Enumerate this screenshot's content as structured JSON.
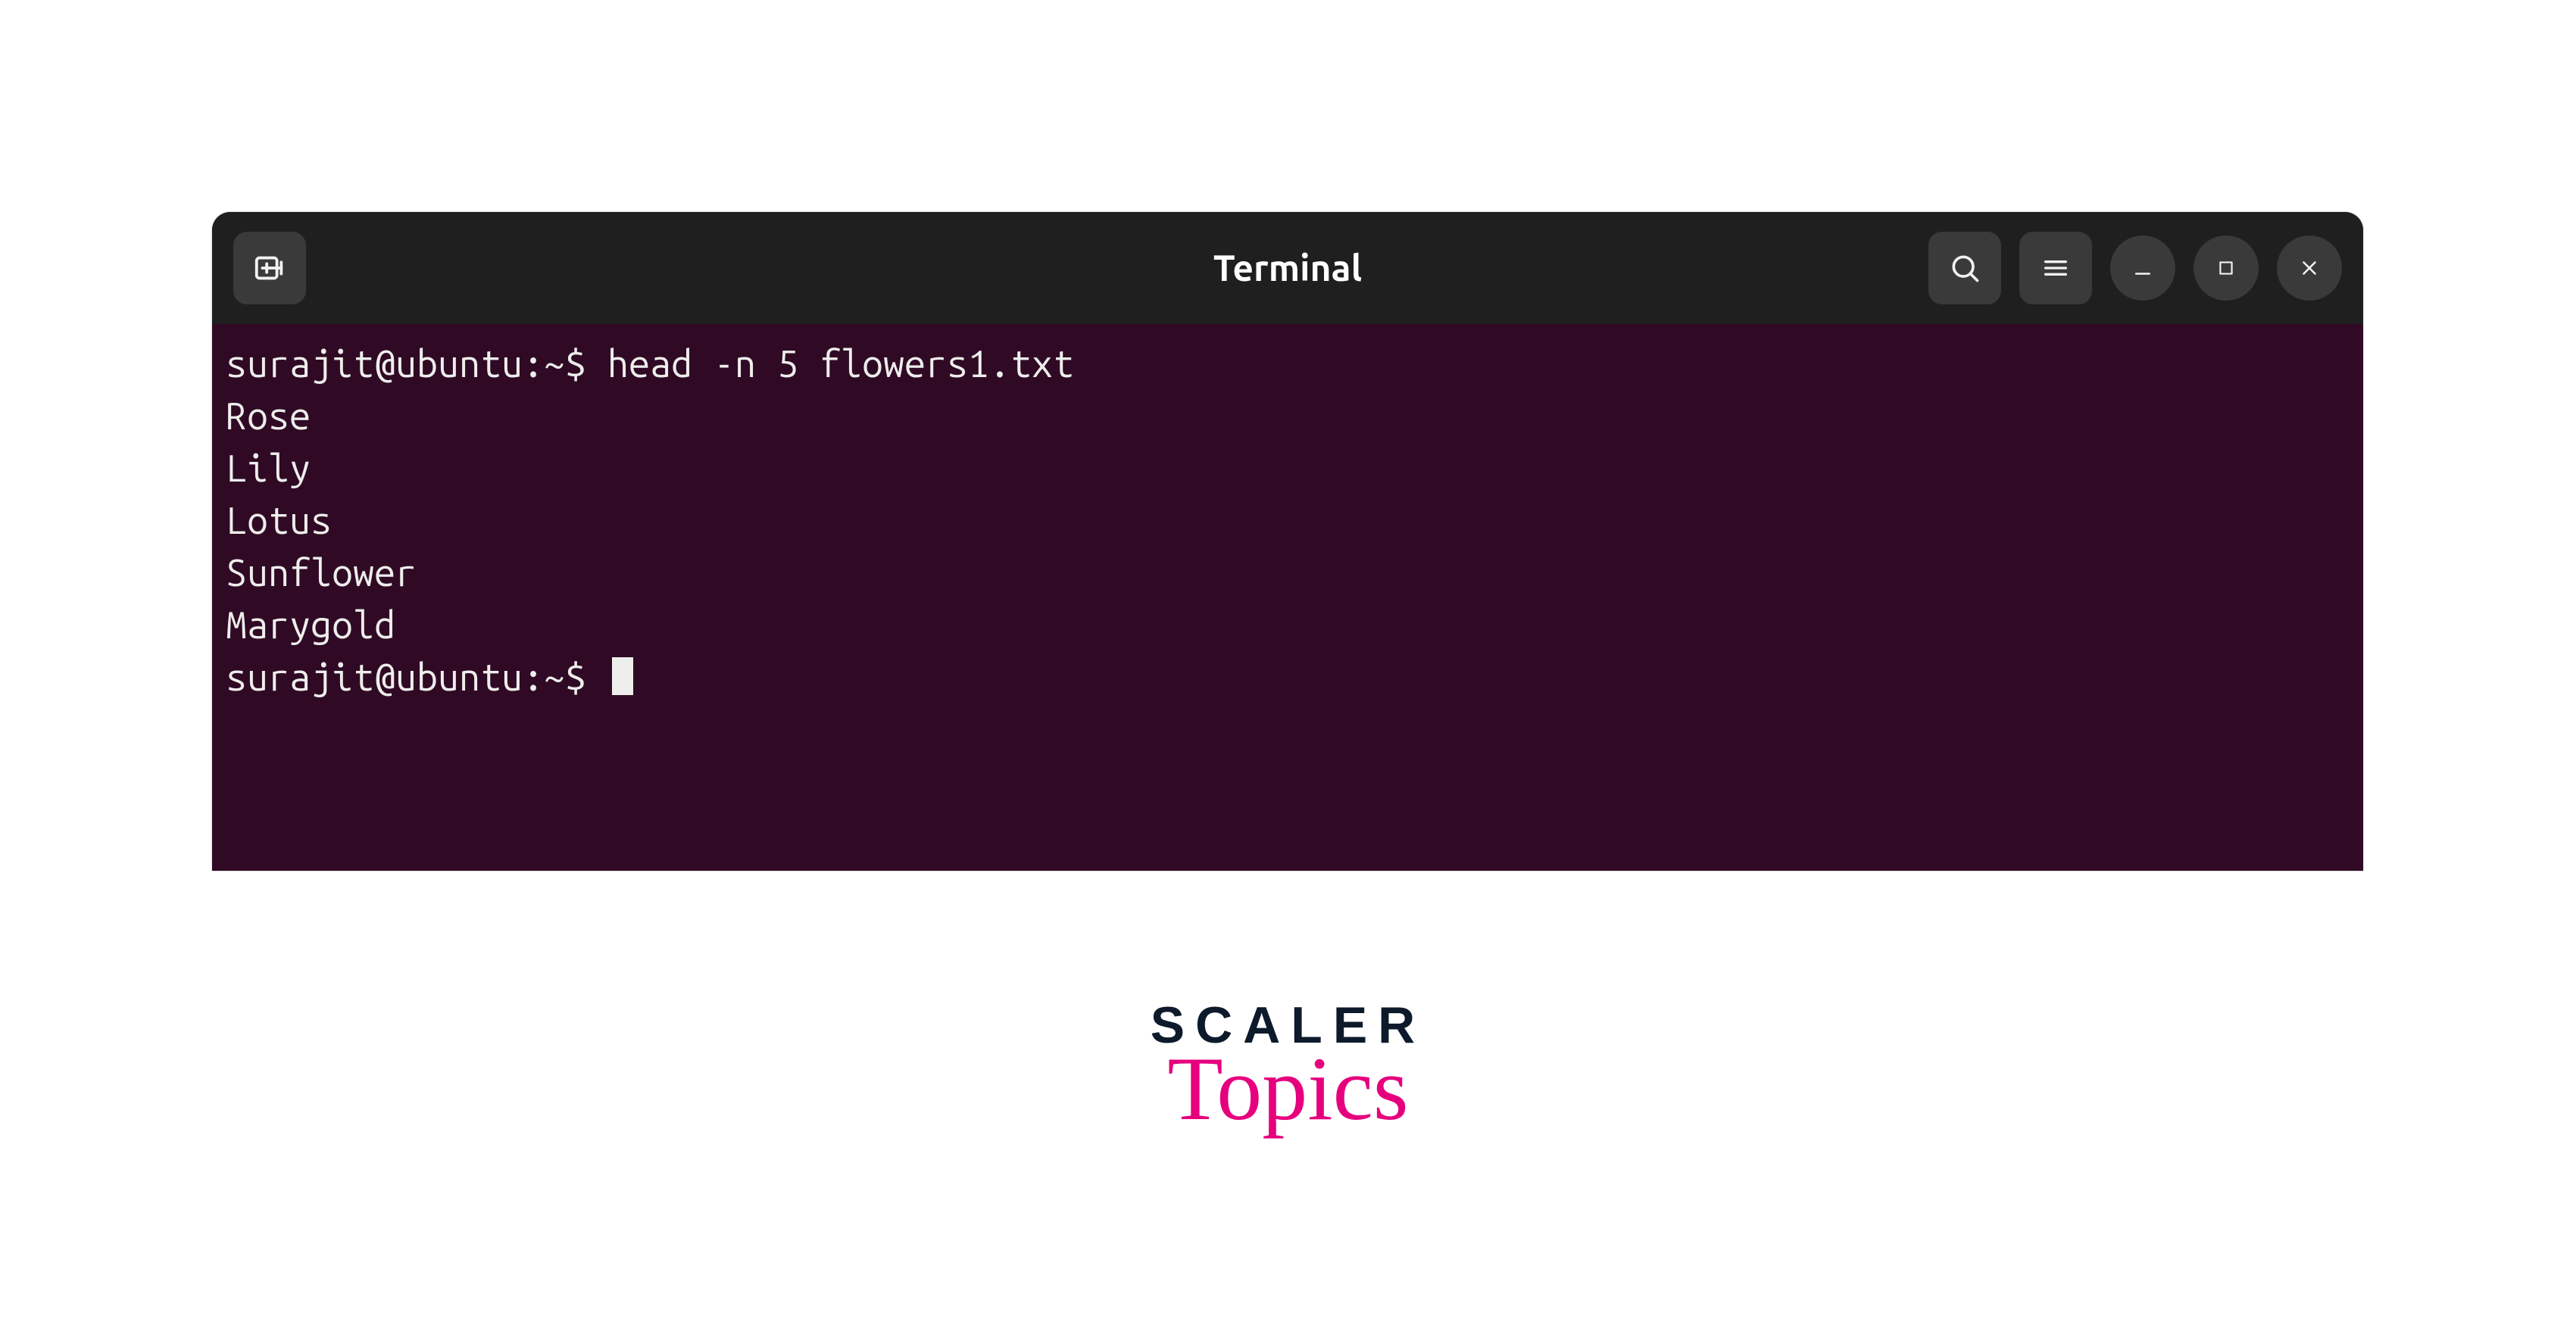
{
  "window": {
    "title": "Terminal"
  },
  "terminal": {
    "prompt_user_host": "surajit@ubuntu",
    "prompt_path_sep": ":",
    "prompt_cwd": "~",
    "prompt_suffix": "$",
    "command": "head -n 5 flowers1.txt",
    "output": [
      "Rose",
      "Lily",
      "Lotus",
      "Sunflower",
      "Marygold"
    ]
  },
  "logo": {
    "line1": "SCALER",
    "line2": "Topics"
  },
  "colors": {
    "terminal_bg": "#300a24",
    "titlebar_bg": "#1f1f1f",
    "text": "#eeeeec",
    "logo_accent": "#e6007e",
    "logo_dark": "#0d1a2b"
  }
}
